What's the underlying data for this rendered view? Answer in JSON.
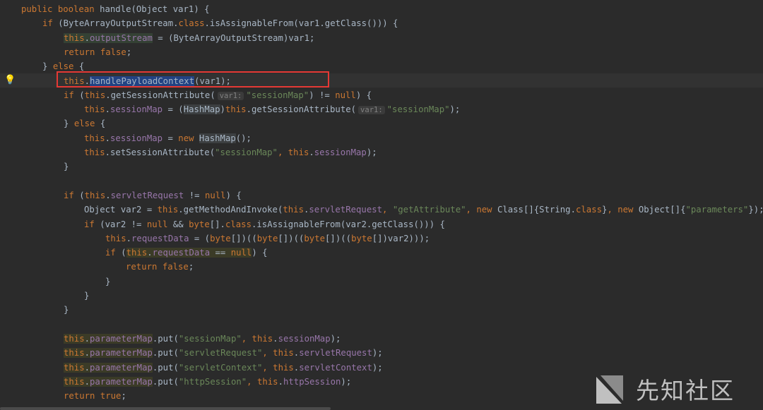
{
  "code_lines": [
    [
      [
        "kw",
        "public boolean "
      ],
      [
        "plain",
        "handle(Object var1) {"
      ]
    ],
    [
      [
        "kw",
        "if "
      ],
      [
        "plain",
        "(ByteArrayOutputStream."
      ],
      [
        "kw",
        "class"
      ],
      [
        "plain",
        ".isAssignableFrom(var1.getClass())) {"
      ]
    ],
    [
      [
        "kw hl-green",
        "this"
      ],
      [
        "plain hl-green",
        "."
      ],
      [
        "fld hl-green",
        "outputStream"
      ],
      [
        "plain",
        " = (ByteArrayOutputStream)var1;"
      ]
    ],
    [
      [
        "kw",
        "return false"
      ],
      [
        "plain",
        ";"
      ]
    ],
    [
      [
        "plain",
        "} "
      ],
      [
        "kw",
        "else "
      ],
      [
        "plain",
        "{"
      ]
    ],
    [
      [
        "kw",
        "this"
      ],
      [
        "plain",
        "."
      ],
      [
        "plain hl-sel",
        "handlePayloadContext"
      ],
      [
        "plain",
        "(var1);"
      ]
    ],
    [
      [
        "kw",
        "if "
      ],
      [
        "plain",
        "("
      ],
      [
        "kw",
        "this"
      ],
      [
        "plain",
        ".getSessionAttribute("
      ],
      [
        "hint",
        "var1:"
      ],
      [
        "str",
        "\"sessionMap\""
      ],
      [
        "plain",
        ") != "
      ],
      [
        "kw",
        "null"
      ],
      [
        "plain",
        ") {"
      ]
    ],
    [
      [
        "kw",
        "this"
      ],
      [
        "plain",
        "."
      ],
      [
        "fld",
        "sessionMap"
      ],
      [
        "plain",
        " = ("
      ],
      [
        "plain hl-gray",
        "HashMap"
      ],
      [
        "plain",
        ")"
      ],
      [
        "kw",
        "this"
      ],
      [
        "plain",
        ".getSessionAttribute("
      ],
      [
        "hint",
        "var1:"
      ],
      [
        "str",
        "\"sessionMap\""
      ],
      [
        "plain",
        ");"
      ]
    ],
    [
      [
        "plain",
        "} "
      ],
      [
        "kw",
        "else "
      ],
      [
        "plain",
        "{"
      ]
    ],
    [
      [
        "kw",
        "this"
      ],
      [
        "plain",
        "."
      ],
      [
        "fld",
        "sessionMap"
      ],
      [
        "plain",
        " = "
      ],
      [
        "kw",
        "new "
      ],
      [
        "plain hl-gray",
        "HashMap"
      ],
      [
        "plain",
        "();"
      ]
    ],
    [
      [
        "kw",
        "this"
      ],
      [
        "plain",
        ".setSessionAttribute("
      ],
      [
        "str",
        "\"sessionMap\""
      ],
      [
        "kw",
        ", this"
      ],
      [
        "plain",
        "."
      ],
      [
        "fld",
        "sessionMap"
      ],
      [
        "plain",
        ");"
      ]
    ],
    [
      [
        "plain",
        "}"
      ]
    ],
    [],
    [
      [
        "kw",
        "if "
      ],
      [
        "plain",
        "("
      ],
      [
        "kw",
        "this"
      ],
      [
        "plain",
        "."
      ],
      [
        "fld",
        "servletRequest"
      ],
      [
        "plain",
        " != "
      ],
      [
        "kw",
        "null"
      ],
      [
        "plain",
        ") {"
      ]
    ],
    [
      [
        "plain",
        "Object var2 = "
      ],
      [
        "kw",
        "this"
      ],
      [
        "plain",
        ".getMethodAndInvoke("
      ],
      [
        "kw",
        "this"
      ],
      [
        "plain",
        "."
      ],
      [
        "fld",
        "servletRequest"
      ],
      [
        "kw",
        ", "
      ],
      [
        "str",
        "\"getAttribute\""
      ],
      [
        "kw",
        ", new "
      ],
      [
        "plain",
        "Class[]{String."
      ],
      [
        "kw",
        "class"
      ],
      [
        "plain",
        "}"
      ],
      [
        "kw",
        ", new "
      ],
      [
        "plain",
        "Object[]{"
      ],
      [
        "str",
        "\"parameters\""
      ],
      [
        "plain",
        "});"
      ]
    ],
    [
      [
        "kw",
        "if "
      ],
      [
        "plain",
        "(var2 != "
      ],
      [
        "kw",
        "null "
      ],
      [
        "plain",
        "&& "
      ],
      [
        "kw",
        "byte"
      ],
      [
        "plain",
        "[]."
      ],
      [
        "kw",
        "class"
      ],
      [
        "plain",
        ".isAssignableFrom(var2.getClass())) {"
      ]
    ],
    [
      [
        "kw",
        "this"
      ],
      [
        "plain",
        "."
      ],
      [
        "fld",
        "requestData"
      ],
      [
        "plain",
        " = ("
      ],
      [
        "kw",
        "byte"
      ],
      [
        "plain",
        "[])(("
      ],
      [
        "kw",
        "byte"
      ],
      [
        "plain",
        "[])(("
      ],
      [
        "kw",
        "byte"
      ],
      [
        "plain",
        "[])(("
      ],
      [
        "kw",
        "byte"
      ],
      [
        "plain",
        "[])var2)));"
      ]
    ],
    [
      [
        "kw",
        "if "
      ],
      [
        "plain",
        "("
      ],
      [
        "kw hl-olive",
        "this"
      ],
      [
        "plain hl-olive",
        "."
      ],
      [
        "fld hl-olive",
        "requestData"
      ],
      [
        "plain hl-olive",
        " == "
      ],
      [
        "kw hl-olive",
        "null"
      ],
      [
        "plain",
        ") {"
      ]
    ],
    [
      [
        "kw",
        "return false"
      ],
      [
        "plain",
        ";"
      ]
    ],
    [
      [
        "plain",
        "}"
      ]
    ],
    [
      [
        "plain",
        "}"
      ]
    ],
    [
      [
        "plain",
        "}"
      ]
    ],
    [],
    [
      [
        "kw hl-olive",
        "this"
      ],
      [
        "plain hl-olive",
        "."
      ],
      [
        "fld hl-olive",
        "parameterMap"
      ],
      [
        "plain",
        ".put("
      ],
      [
        "str",
        "\"sessionMap\""
      ],
      [
        "kw",
        ", this"
      ],
      [
        "plain",
        "."
      ],
      [
        "fld",
        "sessionMap"
      ],
      [
        "plain",
        ");"
      ]
    ],
    [
      [
        "kw hl-olive",
        "this"
      ],
      [
        "plain hl-olive",
        "."
      ],
      [
        "fld hl-olive",
        "parameterMap"
      ],
      [
        "plain",
        ".put("
      ],
      [
        "str",
        "\"servletRequest\""
      ],
      [
        "kw",
        ", this"
      ],
      [
        "plain",
        "."
      ],
      [
        "fld",
        "servletRequest"
      ],
      [
        "plain",
        ");"
      ]
    ],
    [
      [
        "kw hl-olive",
        "this"
      ],
      [
        "plain hl-olive",
        "."
      ],
      [
        "fld hl-olive",
        "parameterMap"
      ],
      [
        "plain",
        ".put("
      ],
      [
        "str",
        "\"servletContext\""
      ],
      [
        "kw",
        ", this"
      ],
      [
        "plain",
        "."
      ],
      [
        "fld",
        "servletContext"
      ],
      [
        "plain",
        ");"
      ]
    ],
    [
      [
        "kw hl-olive",
        "this"
      ],
      [
        "plain hl-olive",
        "."
      ],
      [
        "fld hl-olive",
        "parameterMap"
      ],
      [
        "plain",
        ".put("
      ],
      [
        "str",
        "\"httpSession\""
      ],
      [
        "kw",
        ", this"
      ],
      [
        "plain",
        "."
      ],
      [
        "fld",
        "httpSession"
      ],
      [
        "plain",
        ");"
      ]
    ],
    [
      [
        "kw",
        "return true"
      ],
      [
        "plain",
        ";"
      ]
    ]
  ],
  "watermark": {
    "text": "先知社区",
    "icon": "xianzhi-logo-icon"
  },
  "colors": {
    "background": "#2b2b2b",
    "keyword": "#cc7832",
    "field": "#9876aa",
    "string": "#6a8759",
    "plain": "#a9b7c6",
    "selection": "#214283",
    "annotation_box": "#e53935",
    "intention_bulb": "#e8b83a"
  },
  "gutter": {
    "intention_icon": "lightbulb-icon"
  }
}
